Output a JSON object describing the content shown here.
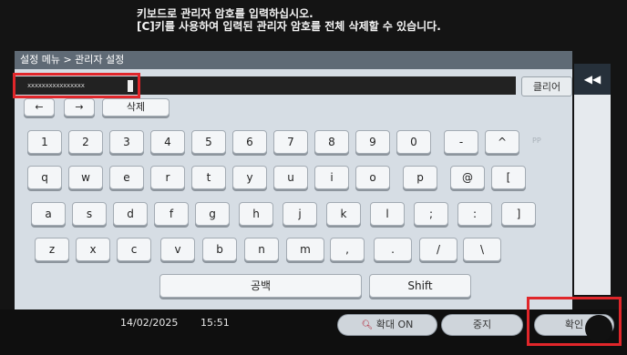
{
  "message": {
    "line1": "키보드로 관리자 암호를 입력하십시오.",
    "line2": "[C]키를 사용하여 입력된 관리자 암호를 전체 삭제할 수 있습니다."
  },
  "breadcrumb": "설정 메뉴 > 관리자 설정",
  "password_field": {
    "masked_value": "xxxxxxxxxxxxxxxx"
  },
  "clear_button": "클리어",
  "side_tab_icon": "◀◀",
  "edit_keys": {
    "left": "←",
    "right": "→",
    "delete": "삭제"
  },
  "keys": {
    "row1": [
      "1",
      "2",
      "3",
      "4",
      "5",
      "6",
      "7",
      "8",
      "9",
      "0",
      "-",
      "^"
    ],
    "row2": [
      "q",
      "w",
      "e",
      "r",
      "t",
      "y",
      "u",
      "i",
      "o",
      "p",
      "@",
      "["
    ],
    "row3": [
      "a",
      "s",
      "d",
      "f",
      "g",
      "h",
      "j",
      "k",
      "l",
      ";",
      ":",
      "]"
    ],
    "row4": [
      "z",
      "x",
      "c",
      "v",
      "b",
      "n",
      "m",
      ",",
      ".",
      "/",
      "\\"
    ],
    "space": "공백",
    "shift": "Shift"
  },
  "faded_hint": "PP",
  "status": {
    "date": "14/02/2025",
    "time": "15:51"
  },
  "bottom_buttons": {
    "zoom": "확대 ON",
    "stop": "중지",
    "ok": "확인"
  }
}
